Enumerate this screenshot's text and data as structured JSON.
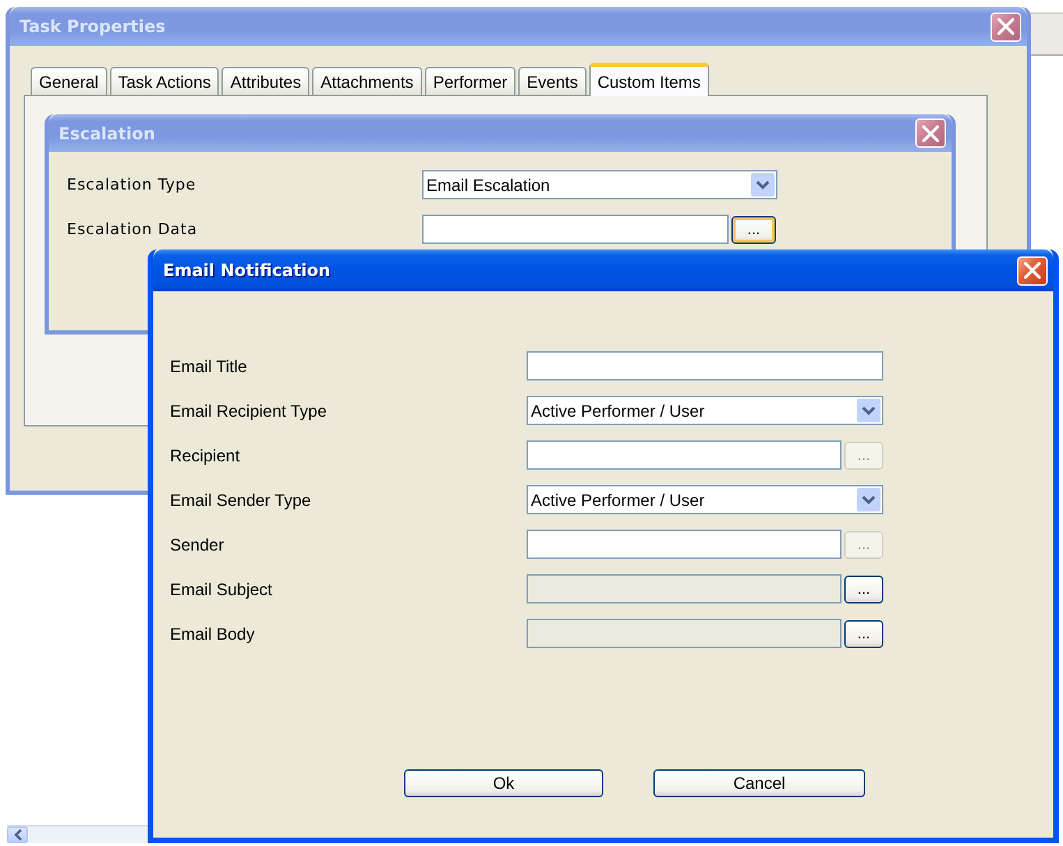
{
  "task_properties": {
    "title": "Task Properties",
    "active": false,
    "tabs": [
      {
        "label": "General",
        "selected": false
      },
      {
        "label": "Task Actions",
        "selected": false
      },
      {
        "label": "Attributes",
        "selected": false
      },
      {
        "label": "Attachments",
        "selected": false
      },
      {
        "label": "Performer",
        "selected": false
      },
      {
        "label": "Events",
        "selected": false
      },
      {
        "label": "Custom Items",
        "selected": true
      }
    ]
  },
  "escalation": {
    "title": "Escalation",
    "active": false,
    "fields": [
      {
        "label": "Escalation Type",
        "kind": "dropdown",
        "value": "Email Escalation",
        "disabled": false
      },
      {
        "label": "Escalation Data",
        "kind": "browse",
        "disabled": false,
        "button": "...",
        "button_disabled": false,
        "button_focused": true
      }
    ]
  },
  "email_notification": {
    "title": "Email Notification",
    "active": true,
    "fields": [
      {
        "label": "Email Title",
        "kind": "text",
        "disabled": false
      },
      {
        "label": "Email Recipient Type",
        "kind": "dropdown",
        "value": "Active Performer / User",
        "disabled": false
      },
      {
        "label": "Recipient",
        "kind": "browse",
        "disabled": false,
        "button": "...",
        "button_disabled": true,
        "button_focused": false
      },
      {
        "label": "Email Sender Type",
        "kind": "dropdown",
        "value": "Active Performer / User",
        "disabled": false
      },
      {
        "label": "Sender",
        "kind": "browse",
        "disabled": false,
        "button": "...",
        "button_disabled": true,
        "button_focused": false
      },
      {
        "label": "Email Subject",
        "kind": "browse",
        "disabled": true,
        "button": "...",
        "button_disabled": false,
        "button_focused": false
      },
      {
        "label": "Email Body",
        "kind": "browse",
        "disabled": true,
        "button": "...",
        "button_disabled": false,
        "button_focused": false
      }
    ],
    "buttons": [
      "Ok",
      "Cancel"
    ]
  }
}
